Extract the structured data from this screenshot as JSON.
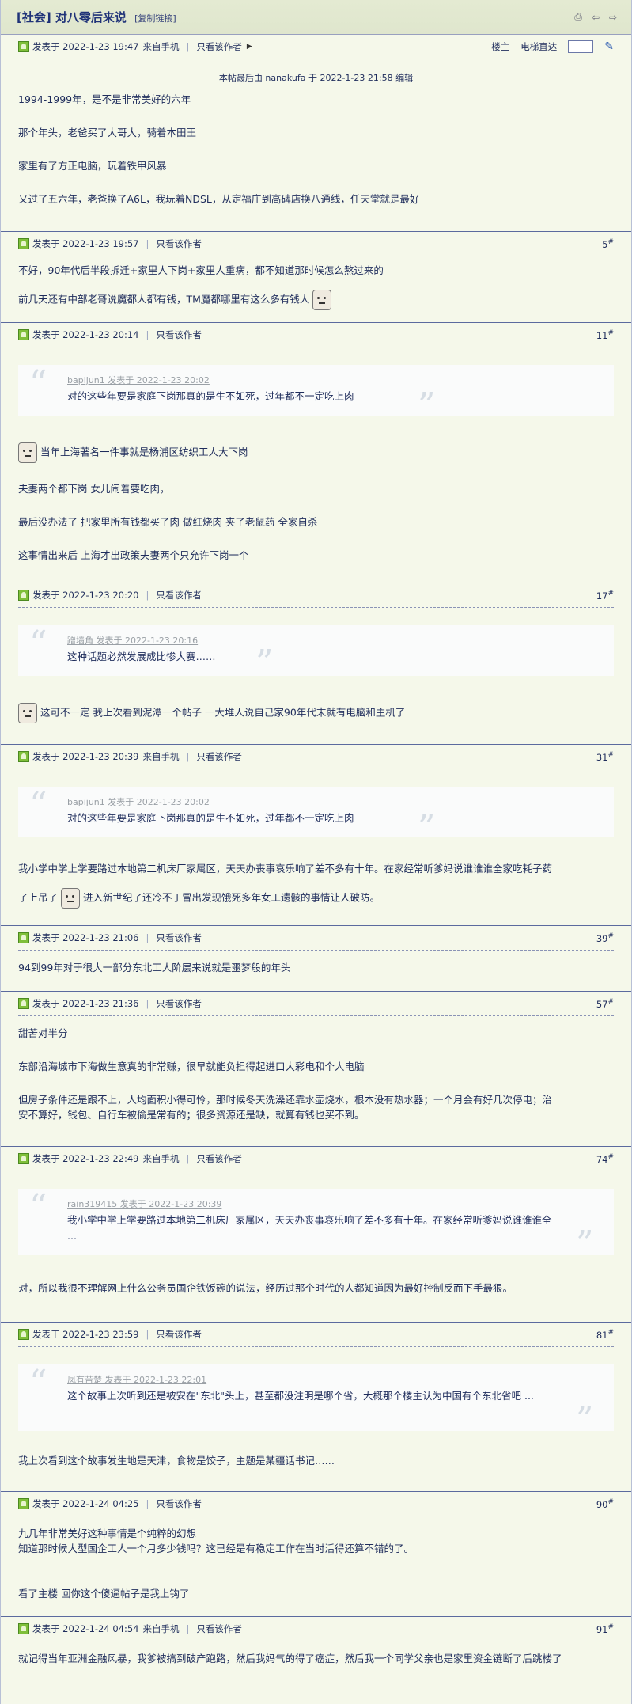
{
  "header": {
    "title": "[社会] 对八零后来说",
    "copy_link": "[复制链接]",
    "icons": [
      "print-icon",
      "prev-thread-icon",
      "next-thread-icon"
    ]
  },
  "labels": {
    "only_author": "只看该作者",
    "louzhu": "楼主",
    "goto_floor": "电梯直达"
  },
  "posts": [
    {
      "posted": "发表于 2022-1-23 19:47",
      "source": "来自手机",
      "edit_note": "本帖最后由 nanakufa 于 2022-1-23 21:58 编辑",
      "lines": [
        "1994-1999年，是不是非常美好的六年",
        "那个年头，老爸买了大哥大，骑着本田王",
        "家里有了方正电脑，玩着铁甲风暴",
        "又过了五六年，老爸换了A6L，我玩着NDSL，从定福庄到高碑店换八通线，任天堂就是最好"
      ]
    },
    {
      "posted": "发表于 2022-1-23 19:57",
      "floor": "5",
      "lines": [
        "不好，90年代后半段拆迁+家里人下岗+家里人重病，都不知道那时候怎么熬过来的",
        "前几天还有中部老哥说魔都人都有钱，TM魔都哪里有这么多有钱人"
      ]
    },
    {
      "posted": "发表于 2022-1-23 20:14",
      "floor": "11",
      "quote": {
        "head": "bapijun1 发表于 2022-1-23 20:02",
        "text": "对的这些年要是家庭下岗那真的是生不如死，过年都不一定吃上肉"
      },
      "lines": [
        "当年上海著名一件事就是杨浦区纺织工人大下岗",
        "夫妻两个都下岗 女儿闹着要吃肉，",
        "最后没办法了 把家里所有钱都买了肉 做红烧肉 夹了老鼠药  全家自杀",
        "这事情出来后 上海才出政策夫妻两个只允许下岗一个"
      ]
    },
    {
      "posted": "发表于 2022-1-23 20:20",
      "floor": "17",
      "quote": {
        "head": "蹭墙角 发表于 2022-1-23 20:16",
        "text": "这种话题必然发展成比惨大赛……"
      },
      "lines": [
        "这可不一定 我上次看到泥潭一个帖子 一大堆人说自己家90年代末就有电脑和主机了"
      ]
    },
    {
      "posted": "发表于 2022-1-23 20:39",
      "source": "来自手机",
      "floor": "31",
      "quote": {
        "head": "bapijun1 发表于 2022-1-23 20:02",
        "text": "对的这些年要是家庭下岗那真的是生不如死，过年都不一定吃上肉"
      },
      "lines": [
        "我小学中学上学要路过本地第二机床厂家属区，天天办丧事哀乐响了差不多有十年。在家经常听爹妈说谁谁谁全家吃耗子药",
        "了上吊了",
        "进入新世纪了还冷不丁冒出发现饿死多年女工遗骸的事情让人破防。"
      ]
    },
    {
      "posted": "发表于 2022-1-23 21:06",
      "floor": "39",
      "lines": [
        "94到99年对于很大一部分东北工人阶层来说就是噩梦般的年头"
      ]
    },
    {
      "posted": "发表于 2022-1-23 21:36",
      "floor": "57",
      "lines": [
        "甜苦对半分",
        "东部沿海城市下海做生意真的非常赚，很早就能负担得起进口大彩电和个人电脑",
        "但房子条件还是跟不上，人均面积小得可怜，那时候冬天洗澡还靠水壶烧水，根本没有热水器；一个月会有好几次停电；治",
        "安不算好，钱包、自行车被偷是常有的；很多资源还是缺，就算有钱也买不到。"
      ]
    },
    {
      "posted": "发表于 2022-1-23 22:49",
      "source": "来自手机",
      "floor": "74",
      "quote": {
        "head": "rain319415 发表于 2022-1-23 20:39",
        "text": "我小学中学上学要路过本地第二机床厂家属区，天天办丧事哀乐响了差不多有十年。在家经常听爹妈说谁谁谁全 ..."
      },
      "lines": [
        "对，所以我很不理解网上什么公务员国企铁饭碗的说法，经历过那个时代的人都知道因为最好控制反而下手最狠。"
      ]
    },
    {
      "posted": "发表于 2022-1-23 23:59",
      "floor": "81",
      "quote": {
        "head": "凤有苦楚 发表于 2022-1-23 22:01",
        "text": "这个故事上次听到还是被安在\"东北\"头上，甚至都没注明是哪个省，大概那个楼主认为中国有个东北省吧 ..."
      },
      "lines": [
        "我上次看到这个故事发生地是天津，食物是饺子，主题是某疆话书记……"
      ]
    },
    {
      "posted": "发表于 2022-1-24 04:25",
      "floor": "90",
      "lines": [
        "九几年非常美好这种事情是个纯粹的幻想",
        "知道那时候大型国企工人一个月多少钱吗？这已经是有稳定工作在当时活得还算不错的了。",
        "看了主楼 回你这个傻逼帖子是我上钩了"
      ]
    },
    {
      "posted": "发表于 2022-1-24 04:54",
      "source": "来自手机",
      "floor": "91",
      "lines": [
        "就记得当年亚洲金融风暴，我爹被搞到破产跑路，然后我妈气的得了癌症，然后我一个同学父亲也是家里资金链断了后跳楼了"
      ]
    }
  ]
}
